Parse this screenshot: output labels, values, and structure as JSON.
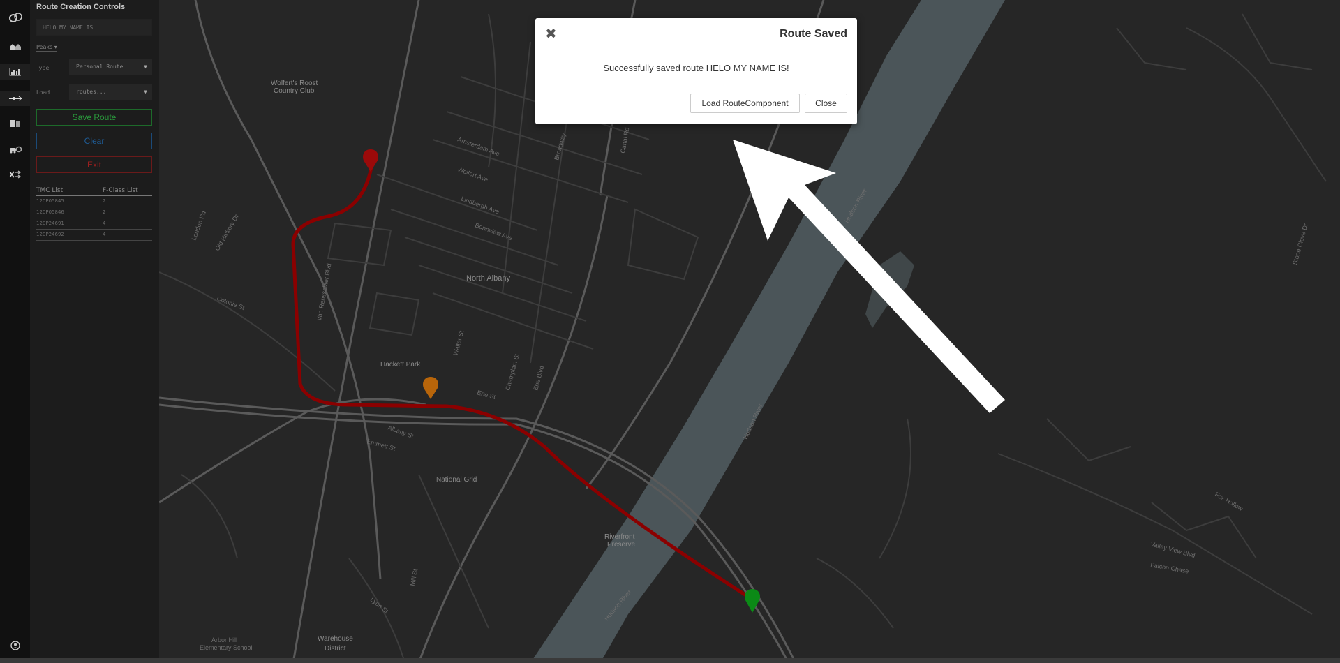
{
  "rail": {
    "icons": [
      "logo-icon",
      "home-icon",
      "chart-icon",
      "route-icon",
      "document-icon",
      "car-icon",
      "shuffle-icon",
      "user-icon"
    ]
  },
  "sidebar": {
    "title": "Route Creation Controls",
    "name_input_value": "HELO MY NAME IS",
    "peaks_label": "Peaks ▾",
    "type_label": "Type",
    "type_value": "Personal Route",
    "load_label": "Load",
    "load_value": "routes...",
    "save_label": "Save Route",
    "clear_label": "Clear",
    "exit_label": "Exit",
    "table": {
      "headers": [
        "TMC List",
        "F-Class List"
      ],
      "rows": [
        [
          "120P05845",
          "2"
        ],
        [
          "120P05846",
          "2"
        ],
        [
          "120P24691",
          "4"
        ],
        [
          "120P24692",
          "4"
        ]
      ]
    }
  },
  "modal": {
    "title": "Route Saved",
    "message": "Successfully saved route HELO MY NAME IS!",
    "load_button": "Load RouteComponent",
    "close_button": "Close"
  },
  "map": {
    "labels": {
      "wolferts": "Wolfert's Roost",
      "country_club": "Country Club",
      "north_albany": "North Albany",
      "hackett_park": "Hackett Park",
      "national_grid": "National Grid",
      "riverfront": "Riverfront",
      "preserve": "Preserve",
      "warehouse": "Warehouse",
      "district": "District",
      "arbor_hill": "Arbor Hill",
      "elementary": "Elementary School",
      "hudson_river_1": "Hudson River",
      "hudson_river_2": "Hudson River",
      "hudson_river_3": "Hudson River",
      "van_rensselaer": "Van Rensselaer Blvd",
      "erie_st": "Erie St",
      "erie_blvd": "Erie Blvd",
      "amsterdam": "Amsterdam Ave",
      "wolfert_ave": "Wolfert Ave",
      "lindbergh": "Lindbergh Ave",
      "bonnview": "Bonnview Ave",
      "emmett": "Emmett St",
      "albany_st": "Albany St",
      "lyon_st": "Lyon St",
      "mill_st": "Mill St",
      "walter_st": "Walter St",
      "champlain": "Champlain St",
      "broadway": "Broadway",
      "canal_rd": "Canal Rd",
      "old_hickory": "Old Hickory Dr",
      "fox_hollow": "Fox Hollow",
      "valley_view": "Valley View Blvd",
      "falcon_chase": "Falcon Chase",
      "stone_clove": "Stone Clove Dr",
      "loudon_rd": "Loudon Rd",
      "colonie": "Colonie St"
    },
    "route_color": "#8b0000",
    "marker_colors": {
      "start": "#9b0a0a",
      "mid": "#b8650a",
      "end": "#0b8a16"
    }
  }
}
